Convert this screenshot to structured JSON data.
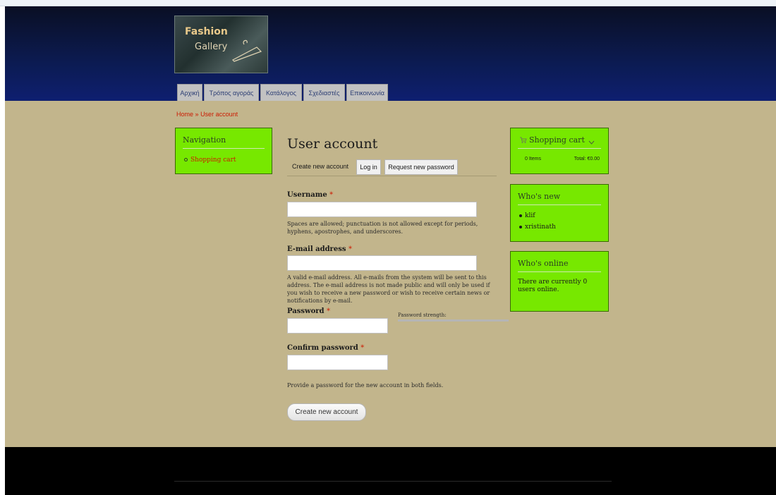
{
  "logo": {
    "line1": "Fashion",
    "line2": "Gallery"
  },
  "nav_tabs": [
    "Αρχική",
    "Τρόπος αγοράς",
    "Κατάλογος",
    "Σχεδιαστές",
    "Επικοινωνία"
  ],
  "breadcrumb": {
    "home": "Home",
    "separator": "»",
    "current": "User account"
  },
  "navigation_block": {
    "title": "Navigation",
    "items": [
      "Shopping cart"
    ]
  },
  "cart_block": {
    "title": "Shopping cart",
    "items": "0 Items",
    "total": "Total: €0.00"
  },
  "whos_new": {
    "title": "Who's new",
    "users": [
      "klif",
      "xristinath"
    ]
  },
  "whos_online": {
    "title": "Who's online",
    "text": "There are currently 0 users online."
  },
  "main": {
    "title": "User account",
    "tabs": [
      "Create new account",
      "Log in",
      "Request new password"
    ],
    "username": {
      "label": "Username",
      "required": "*",
      "value": "",
      "description": "Spaces are allowed; punctuation is not allowed except for periods, hyphens, apostrophes, and underscores."
    },
    "email": {
      "label": "E-mail address",
      "required": "*",
      "value": "",
      "description": "A valid e-mail address. All e-mails from the system will be sent to this address. The e-mail address is not made public and will only be used if you wish to receive a new password or wish to receive certain news or notifications by e-mail."
    },
    "password": {
      "label": "Password",
      "required": "*",
      "value": "",
      "strength_label": "Password strength:"
    },
    "confirm": {
      "label": "Confirm password",
      "required": "*",
      "value": "",
      "description": "Provide a password for the new account in both fields."
    },
    "submit": "Create new account"
  },
  "colors": {
    "header": "#0c1b52",
    "band": "#c2b58c",
    "block": "#77e800",
    "link": "#cc1a00",
    "footer": "#000000"
  }
}
